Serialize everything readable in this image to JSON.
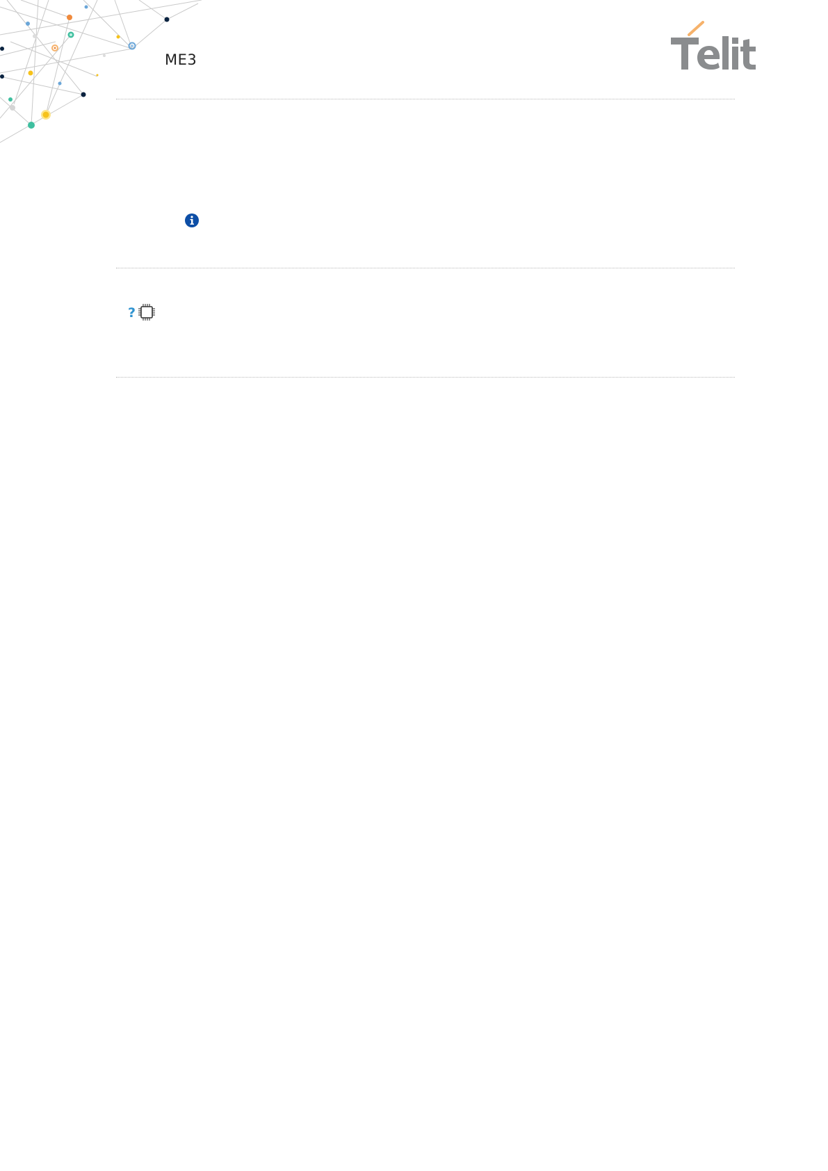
{
  "header": {
    "title": "ME3",
    "logo_text": "Telit"
  },
  "icons": {
    "info": "info-icon",
    "question": "question-icon",
    "chip": "chip-icon"
  },
  "colors": {
    "logo_gray": "#8a8c8e",
    "logo_accent": "#f6b26b",
    "info_blue": "#0d4ea6",
    "question_blue": "#2f93d0"
  }
}
